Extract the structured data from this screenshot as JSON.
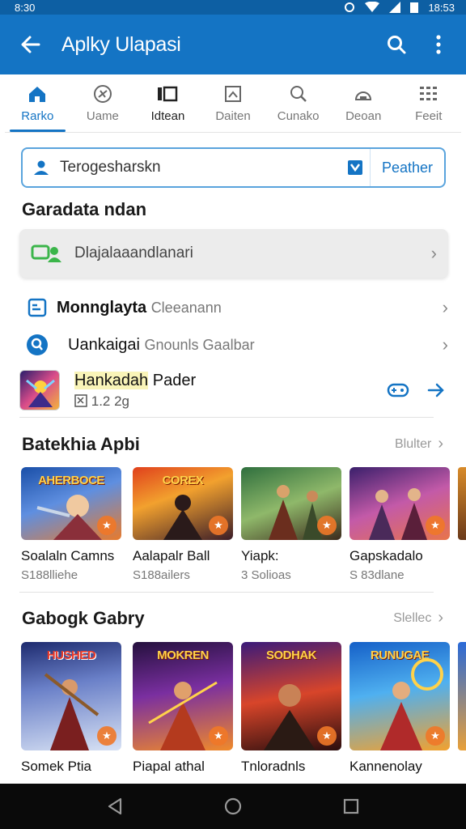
{
  "status": {
    "time": "8:30",
    "clock": "18:53"
  },
  "appbar": {
    "title": "Aplky Ulapasi"
  },
  "tabs": [
    {
      "label": "Rarko",
      "icon": "home-icon"
    },
    {
      "label": "Uame",
      "icon": "gamepad-icon"
    },
    {
      "label": "Idtean",
      "icon": "grid-icon"
    },
    {
      "label": "Daiten",
      "icon": "image-icon"
    },
    {
      "label": "Cunako",
      "icon": "search-icon"
    },
    {
      "label": "Deoan",
      "icon": "cloud-icon"
    },
    {
      "label": "Feeit",
      "icon": "apps-icon"
    }
  ],
  "search": {
    "value": "Terogesharskn",
    "filter_label": "Peather"
  },
  "section1": {
    "title": "Garadata ndan"
  },
  "banner": {
    "text": "Dlajalaaandlanari"
  },
  "rows": [
    {
      "title": "Monnglayta",
      "sub": "Cleeanann"
    },
    {
      "title": "Uankaigai",
      "sub": "Gnounls Gaalbar"
    }
  ],
  "featured": {
    "name": "Hankadah",
    "name_rest": " Pader",
    "meta": "1.2 2g"
  },
  "section2": {
    "title": "Batekhia Apbi",
    "see_all": "Blulter"
  },
  "row1_cards": [
    {
      "art": "AHERBOCE",
      "name": "Soalaln Camns",
      "meta": "S188lliehe"
    },
    {
      "art": "COREX",
      "name": "Aalapalr Ball",
      "meta": "S188ailers"
    },
    {
      "art": "",
      "name": "Yiapk:",
      "meta": "3 Solioas"
    },
    {
      "art": "",
      "name": "Gapskadalo",
      "meta": "S 83dlane"
    }
  ],
  "section3": {
    "title": "Gabogk Gabry",
    "see_all": "Slellec"
  },
  "row2_cards": [
    {
      "art": "HUSHED",
      "name": "Somek Ptia",
      "meta": ""
    },
    {
      "art": "MOKREN",
      "name": "Piapal athal",
      "meta": ""
    },
    {
      "art": "SODHAK",
      "name": "Tnloradnls",
      "meta": ""
    },
    {
      "art": "RUNUGAE",
      "name": "Kannenolay",
      "meta": ""
    }
  ],
  "colors": {
    "primary": "#1474c4",
    "statusbar": "#0d5fa3",
    "navbar": "#0a0a0a"
  }
}
